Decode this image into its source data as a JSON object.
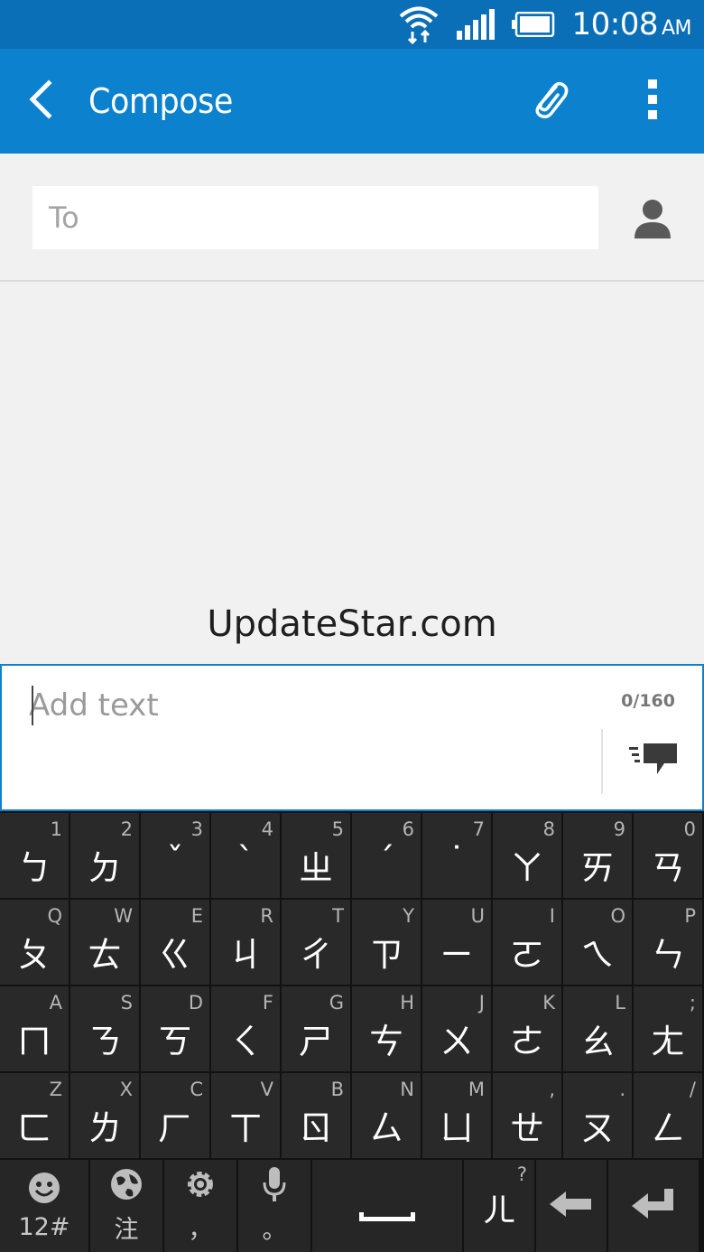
{
  "status_bar": {
    "time": "10:08",
    "ampm": "AM",
    "icons": [
      "wifi-icon",
      "signal-icon",
      "battery-icon"
    ]
  },
  "app_bar": {
    "title": "Compose",
    "icons": [
      "back-arrow-icon",
      "paperclip-icon",
      "more-vert-icon"
    ]
  },
  "recipient": {
    "placeholder": "To",
    "icon": "person-icon"
  },
  "watermark": "UpdateStar.com",
  "message": {
    "placeholder": "Add text",
    "counter": "0/160",
    "send_icon": "send-message-icon"
  },
  "keyboard": {
    "rows": [
      [
        {
          "hint": "1",
          "glyph": "ㄅ"
        },
        {
          "hint": "2",
          "glyph": "ㄉ"
        },
        {
          "hint": "3",
          "glyph": "ˇ"
        },
        {
          "hint": "4",
          "glyph": "ˋ"
        },
        {
          "hint": "5",
          "glyph": "ㄓ"
        },
        {
          "hint": "6",
          "glyph": "ˊ"
        },
        {
          "hint": "7",
          "glyph": "˙"
        },
        {
          "hint": "8",
          "glyph": "ㄚ"
        },
        {
          "hint": "9",
          "glyph": "ㄞ"
        },
        {
          "hint": "0",
          "glyph": "ㄢ"
        }
      ],
      [
        {
          "hint": "Q",
          "glyph": "ㄆ"
        },
        {
          "hint": "W",
          "glyph": "ㄊ"
        },
        {
          "hint": "E",
          "glyph": "ㄍ"
        },
        {
          "hint": "R",
          "glyph": "ㄐ"
        },
        {
          "hint": "T",
          "glyph": "ㄔ"
        },
        {
          "hint": "Y",
          "glyph": "ㄗ"
        },
        {
          "hint": "U",
          "glyph": "ㄧ"
        },
        {
          "hint": "I",
          "glyph": "ㄛ"
        },
        {
          "hint": "O",
          "glyph": "ㄟ"
        },
        {
          "hint": "P",
          "glyph": "ㄣ"
        }
      ],
      [
        {
          "hint": "A",
          "glyph": "ㄇ"
        },
        {
          "hint": "S",
          "glyph": "ㄋ"
        },
        {
          "hint": "D",
          "glyph": "ㄎ"
        },
        {
          "hint": "F",
          "glyph": "ㄑ"
        },
        {
          "hint": "G",
          "glyph": "ㄕ"
        },
        {
          "hint": "H",
          "glyph": "ㄘ"
        },
        {
          "hint": "J",
          "glyph": "ㄨ"
        },
        {
          "hint": "K",
          "glyph": "ㄜ"
        },
        {
          "hint": "L",
          "glyph": "ㄠ"
        },
        {
          "hint": ";",
          "glyph": "ㄤ"
        }
      ],
      [
        {
          "hint": "Z",
          "glyph": "ㄈ"
        },
        {
          "hint": "X",
          "glyph": "ㄌ"
        },
        {
          "hint": "C",
          "glyph": "ㄏ"
        },
        {
          "hint": "V",
          "glyph": "ㄒ"
        },
        {
          "hint": "B",
          "glyph": "ㄖ"
        },
        {
          "hint": "N",
          "glyph": "ㄙ"
        },
        {
          "hint": "M",
          "glyph": "ㄩ"
        },
        {
          "hint": ",",
          "glyph": "ㄝ"
        },
        {
          "hint": ".",
          "glyph": "ㄡ"
        },
        {
          "hint": "/",
          "glyph": "ㄥ"
        }
      ]
    ],
    "function_row": [
      {
        "icon": "emoji-icon",
        "label": "12#"
      },
      {
        "icon": "globe-icon",
        "label": "注"
      },
      {
        "icon": "settings-icon",
        "label": "，"
      },
      {
        "icon": "microphone-icon",
        "label": "。"
      },
      {
        "icon": "space-icon",
        "label": ""
      },
      {
        "icon": "",
        "label": "ㄦ",
        "hint": "?"
      },
      {
        "icon": "backspace-icon",
        "label": ""
      },
      {
        "icon": "enter-icon",
        "label": ""
      }
    ]
  }
}
